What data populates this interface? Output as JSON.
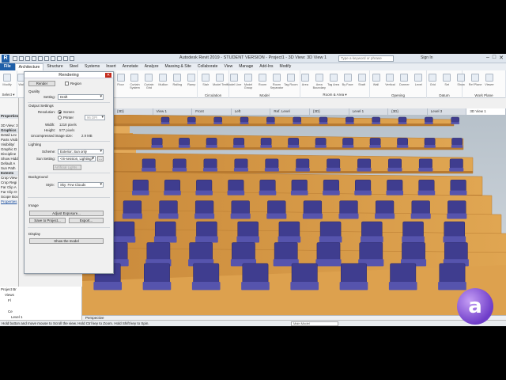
{
  "app": {
    "title": "Autodesk Revit 2019 - STUDENT VERSION - Project1 - 3D View: 3D View 1",
    "search_placeholder": "Type a keyword or phrase",
    "signin_label": "Sign In",
    "logo_letter": "R"
  },
  "ribbon": {
    "tabs": [
      "File",
      "Architecture",
      "Structure",
      "Steel",
      "Systems",
      "Insert",
      "Annotate",
      "Analyze",
      "Massing & Site",
      "Collaborate",
      "View",
      "Manage",
      "Add-Ins",
      "Modify"
    ],
    "active_tab": "Architecture",
    "groups": [
      "Select ▾",
      "Build",
      "Circulation",
      "Model",
      "Room & Area ▾",
      "Opening",
      "Datum",
      "Work Plane"
    ],
    "buttons": [
      "Modify",
      "Wall",
      "Door",
      "Window",
      "Component",
      "Column",
      "Roof",
      "Ceiling",
      "Floor",
      "Curtain System",
      "Curtain Grid",
      "Mullion",
      "Railing",
      "Ramp",
      "Stair",
      "Model Text",
      "Model Line",
      "Model Group",
      "Room",
      "Room Separator",
      "Tag Room",
      "Area",
      "Area Boundary",
      "Tag Area",
      "By Face",
      "Shaft",
      "Wall",
      "Vertical",
      "Dormer",
      "Level",
      "Grid",
      "Set",
      "Show",
      "Ref Plane",
      "Viewer"
    ]
  },
  "view_tabs": [
    "{3D}",
    "View 1",
    "Front",
    "Left",
    "Ref. Level",
    "{3D}",
    "Level 1",
    "{3D}",
    "Level 3",
    "3D View 1"
  ],
  "active_view_tab": "3D View 1",
  "properties_lines": [
    "Properties",
    "",
    "3D View: 3",
    "Graphics",
    "Detail Lev",
    "Parts Visib",
    "Visibility/",
    "Graphic D",
    "Discipline",
    "Show Hidd",
    "Default A",
    "Sun Path",
    "Extents",
    "Crop View",
    "Crop Regi",
    "Far Clip A",
    "Far Clip O",
    "Scope Box",
    "Properties"
  ],
  "browser_lines": [
    "Project Br",
    "Views",
    "Fl",
    "",
    "Ce",
    "Level 1",
    "Level 2",
    "3D Views",
    "Elevations (Building Elevation)",
    "East",
    "North",
    "South",
    "West"
  ],
  "dialog": {
    "title": "Rendering",
    "render_button": "Render",
    "region_label": "Region",
    "quality_section": "Quality",
    "setting_label": "Setting:",
    "setting_value": "Draft",
    "output_section": "Output Settings",
    "resolution_label": "Resolution:",
    "screen_label": "Screen",
    "printer_label": "Printer",
    "dpi_value": "96 DPI",
    "width_label": "Width:",
    "width_value": "1218 pixels",
    "height_label": "Height:",
    "height_value": "577 pixels",
    "size_label": "Uncompressed image size:",
    "size_value": "2.9 MB",
    "lighting_section": "Lighting",
    "scheme_label": "Scheme:",
    "scheme_value": "Exterior: Sun only",
    "sun_label": "Sun Setting:",
    "sun_value": "<In-session, Lighting>",
    "artificial_button": "Artificial Lights...",
    "background_section": "Background",
    "style_label": "Style:",
    "style_value": "Sky: Few Clouds",
    "image_section": "Image",
    "adjust_button": "Adjust Exposure...",
    "save_button": "Save to Project...",
    "export_button": "Export...",
    "display_section": "Display",
    "show_model_button": "Show the model"
  },
  "viewport": {
    "view_mode": "Perspective"
  },
  "status": {
    "message": "Hold button and move mouse to Scroll the view. Hold Ctrl key to Zoom. Hold Shift key to Spin.",
    "model_label": "Main Model"
  },
  "badge": {
    "letter": "a"
  },
  "colors": {
    "wood": "#dca04a",
    "seat": "#3f3d8f",
    "accent": "#1f5fa8",
    "badge": "#7a45d6"
  }
}
